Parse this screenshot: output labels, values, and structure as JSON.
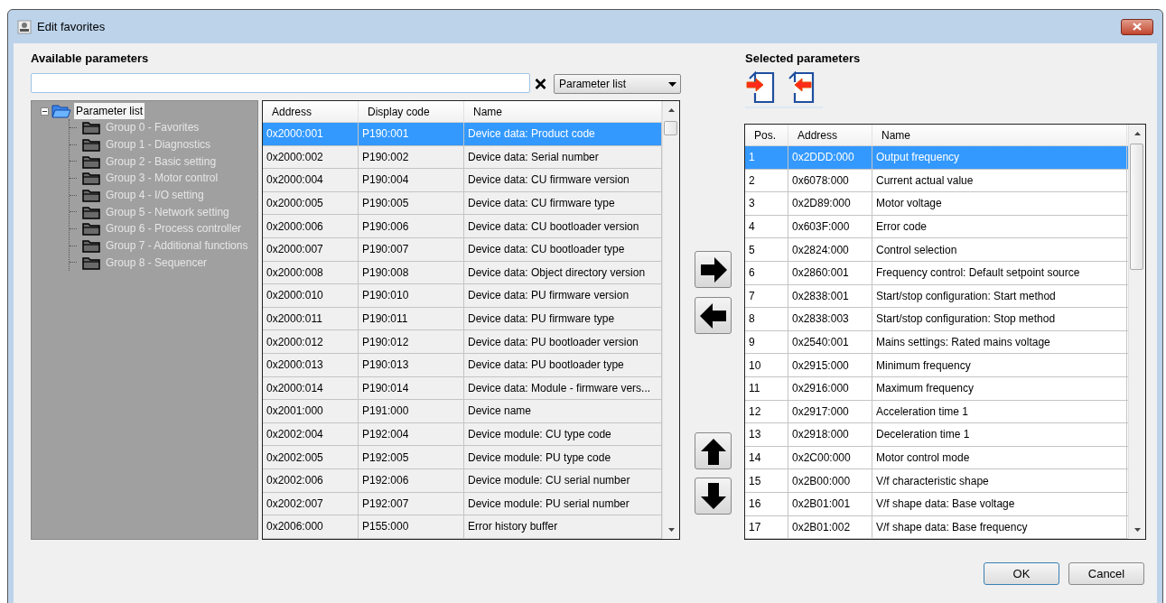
{
  "window": {
    "title": "Edit favorites"
  },
  "available": {
    "heading": "Available parameters",
    "filter": {
      "value": "Parameter list"
    },
    "tree": {
      "label": "Parameter list",
      "selected": true,
      "expanded": true,
      "children": [
        {
          "label": "Group 0 - Favorites",
          "selected": false
        },
        {
          "label": "Group 1 - Diagnostics",
          "selected": false
        },
        {
          "label": "Group 2 - Basic setting",
          "selected": false
        },
        {
          "label": "Group 3 - Motor control",
          "selected": false
        },
        {
          "label": "Group 4 - I/O setting",
          "selected": false
        },
        {
          "label": "Group 5 - Network setting",
          "selected": false
        },
        {
          "label": "Group 6 - Process controller",
          "selected": false
        },
        {
          "label": "Group 7 - Additional functions",
          "selected": false
        },
        {
          "label": "Group 8 - Sequencer",
          "selected": false
        }
      ]
    },
    "table": {
      "columns": [
        "Address",
        "Display code",
        "Name"
      ],
      "rows": [
        {
          "cells": [
            "0x2000:001",
            "P190:001",
            "Device data: Product code"
          ],
          "selected": true
        },
        {
          "cells": [
            "0x2000:002",
            "P190:002",
            "Device data: Serial number"
          ],
          "selected": false
        },
        {
          "cells": [
            "0x2000:004",
            "P190:004",
            "Device data: CU firmware version"
          ],
          "selected": false
        },
        {
          "cells": [
            "0x2000:005",
            "P190:005",
            "Device data: CU firmware type"
          ],
          "selected": false
        },
        {
          "cells": [
            "0x2000:006",
            "P190:006",
            "Device data: CU bootloader version"
          ],
          "selected": false
        },
        {
          "cells": [
            "0x2000:007",
            "P190:007",
            "Device data: CU bootloader type"
          ],
          "selected": false
        },
        {
          "cells": [
            "0x2000:008",
            "P190:008",
            "Device data: Object directory version"
          ],
          "selected": false
        },
        {
          "cells": [
            "0x2000:010",
            "P190:010",
            "Device data: PU firmware version"
          ],
          "selected": false
        },
        {
          "cells": [
            "0x2000:011",
            "P190:011",
            "Device data: PU firmware type"
          ],
          "selected": false
        },
        {
          "cells": [
            "0x2000:012",
            "P190:012",
            "Device data: PU bootloader version"
          ],
          "selected": false
        },
        {
          "cells": [
            "0x2000:013",
            "P190:013",
            "Device data: PU bootloader type"
          ],
          "selected": false
        },
        {
          "cells": [
            "0x2000:014",
            "P190:014",
            "Device data: Module - firmware vers..."
          ],
          "selected": false
        },
        {
          "cells": [
            "0x2001:000",
            "P191:000",
            "Device name"
          ],
          "selected": false
        },
        {
          "cells": [
            "0x2002:004",
            "P192:004",
            "Device module: CU type code"
          ],
          "selected": false
        },
        {
          "cells": [
            "0x2002:005",
            "P192:005",
            "Device module: PU type code"
          ],
          "selected": false
        },
        {
          "cells": [
            "0x2002:006",
            "P192:006",
            "Device module: CU serial number"
          ],
          "selected": false
        },
        {
          "cells": [
            "0x2002:007",
            "P192:007",
            "Device module: PU serial number"
          ],
          "selected": false
        },
        {
          "cells": [
            "0x2006:000",
            "P155:000",
            "Error history buffer"
          ],
          "selected": false
        }
      ]
    }
  },
  "selected_params": {
    "heading": "Selected parameters",
    "table": {
      "columns": [
        "Pos.",
        "Address",
        "Name"
      ],
      "rows": [
        {
          "cells": [
            "1",
            "0x2DDD:000",
            "Output frequency"
          ],
          "selected": true
        },
        {
          "cells": [
            "2",
            "0x6078:000",
            "Current actual value"
          ],
          "selected": false
        },
        {
          "cells": [
            "3",
            "0x2D89:000",
            "Motor voltage"
          ],
          "selected": false
        },
        {
          "cells": [
            "4",
            "0x603F:000",
            "Error code"
          ],
          "selected": false
        },
        {
          "cells": [
            "5",
            "0x2824:000",
            "Control selection"
          ],
          "selected": false
        },
        {
          "cells": [
            "6",
            "0x2860:001",
            "Frequency control: Default setpoint source"
          ],
          "selected": false
        },
        {
          "cells": [
            "7",
            "0x2838:001",
            "Start/stop configuration: Start method"
          ],
          "selected": false
        },
        {
          "cells": [
            "8",
            "0x2838:003",
            "Start/stop configuration: Stop method"
          ],
          "selected": false
        },
        {
          "cells": [
            "9",
            "0x2540:001",
            "Mains settings: Rated mains voltage"
          ],
          "selected": false
        },
        {
          "cells": [
            "10",
            "0x2915:000",
            "Minimum frequency"
          ],
          "selected": false
        },
        {
          "cells": [
            "11",
            "0x2916:000",
            "Maximum frequency"
          ],
          "selected": false
        },
        {
          "cells": [
            "12",
            "0x2917:000",
            "Acceleration time 1"
          ],
          "selected": false
        },
        {
          "cells": [
            "13",
            "0x2918:000",
            "Deceleration time 1"
          ],
          "selected": false
        },
        {
          "cells": [
            "14",
            "0x2C00:000",
            "Motor control mode"
          ],
          "selected": false
        },
        {
          "cells": [
            "15",
            "0x2B00:000",
            "V/f characteristic shape"
          ],
          "selected": false
        },
        {
          "cells": [
            "16",
            "0x2B01:001",
            "V/f shape data: Base voltage"
          ],
          "selected": false
        },
        {
          "cells": [
            "17",
            "0x2B01:002",
            "V/f shape data: Base frequency"
          ],
          "selected": false
        }
      ]
    }
  },
  "buttons": [
    "OK",
    "Cancel"
  ]
}
